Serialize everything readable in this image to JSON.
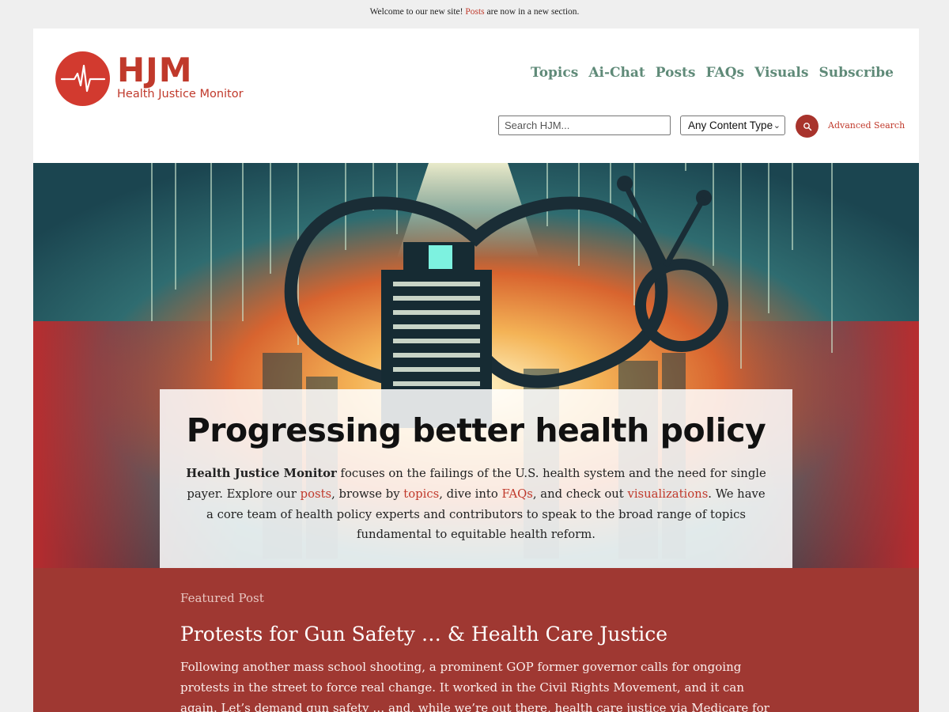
{
  "announcement": {
    "prefix": "Welcome to our new site! ",
    "link": "Posts",
    "suffix": " are now in a new section."
  },
  "logo": {
    "abbr": "HJM",
    "name": "Health Justice Monitor"
  },
  "nav": {
    "items": [
      "Topics",
      "Ai-Chat",
      "Posts",
      "FAQs",
      "Visuals",
      "Subscribe"
    ]
  },
  "search": {
    "placeholder": "Search HJM...",
    "content_type": "Any Content Type",
    "advanced_label": "Advanced Search"
  },
  "hero": {
    "title": "Progressing better health policy",
    "brand": "Health Justice Monitor",
    "text_1": " focuses on the failings of the U.S. health system and the need for single payer. Explore our ",
    "link_posts": "posts",
    "text_2": ", browse by ",
    "link_topics": "topics",
    "text_3": ", dive into ",
    "link_faqs": "FAQs",
    "text_4": ", and check out ",
    "link_visualizations": "visualizations",
    "text_5": ". We have a core team of health policy experts and contributors to speak to the broad range of topics fundamental to equitable health reform."
  },
  "featured": {
    "label": "Featured Post",
    "title": "Protests for Gun Safety … & Health Care Justice",
    "excerpt": "Following another mass school shooting, a prominent GOP former governor calls for ongoing protests in the street to force real change. It worked in the Civil Rights Movement, and it can again. Let’s demand gun safety … and, while we’re out there, health care justice via Medicare for All."
  },
  "colors": {
    "brand_red": "#c0392b",
    "nav_green": "#5f8a78",
    "featured_bg": "#9f3832"
  }
}
